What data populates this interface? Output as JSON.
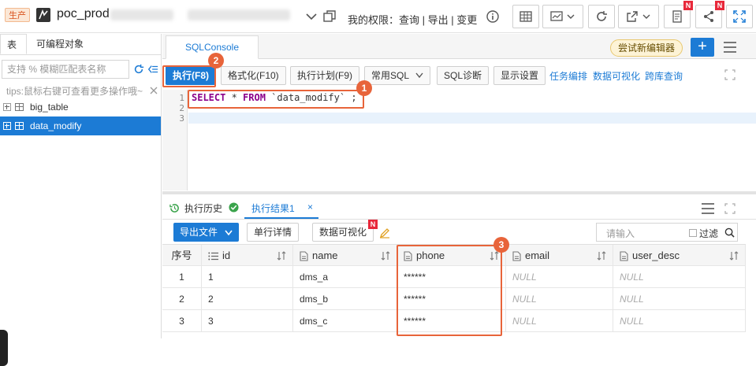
{
  "topbar": {
    "env_badge": "生产",
    "db_name": "poc_prod",
    "permissions": "我的权限：查询 | 导出 | 变更"
  },
  "left": {
    "tabs": [
      "表",
      "可编程对象"
    ],
    "search_placeholder": "支持 % 模糊匹配表名称",
    "tips": "tips:鼠标右键可查看更多操作哦~",
    "tables": [
      {
        "name": "big_table",
        "selected": false
      },
      {
        "name": "data_modify",
        "selected": true
      }
    ]
  },
  "editor": {
    "tab": "SQLConsole",
    "try_new_editor": "尝试新编辑器",
    "plus": "+",
    "toolbar": {
      "execute": "执行(F8)",
      "format": "格式化(F10)",
      "plan": "执行计划(F9)",
      "common_sql": "常用SQL",
      "diagnose": "SQL诊断",
      "display": "显示设置",
      "links": [
        "任务编排",
        "数据可视化",
        "跨库查询"
      ]
    },
    "line_numbers": [
      "1",
      "2",
      "3"
    ],
    "sql": {
      "kw1": "SELECT",
      "star": " * ",
      "kw2": "FROM",
      "table": " `data_modify` ",
      "semi": ";"
    }
  },
  "results": {
    "tabs": [
      "执行历史",
      "执行结果1"
    ],
    "close": "×",
    "export": "导出文件",
    "row_detail": "单行详情",
    "visualize": "数据可视化",
    "search_placeholder": "请输入",
    "filter": "过滤",
    "columns": [
      "序号",
      "id",
      "name",
      "phone",
      "email",
      "user_desc"
    ],
    "rows": [
      [
        "1",
        "1",
        "dms_a",
        "******",
        "NULL",
        "NULL"
      ],
      [
        "2",
        "2",
        "dms_b",
        "******",
        "NULL",
        "NULL"
      ],
      [
        "3",
        "3",
        "dms_c",
        "******",
        "NULL",
        "NULL"
      ]
    ]
  },
  "annotations": {
    "markers": [
      "1",
      "2",
      "3"
    ],
    "color": "#e8643a"
  },
  "colors": {
    "accent": "#1c7bd5",
    "new_badge": "#e8283a"
  }
}
